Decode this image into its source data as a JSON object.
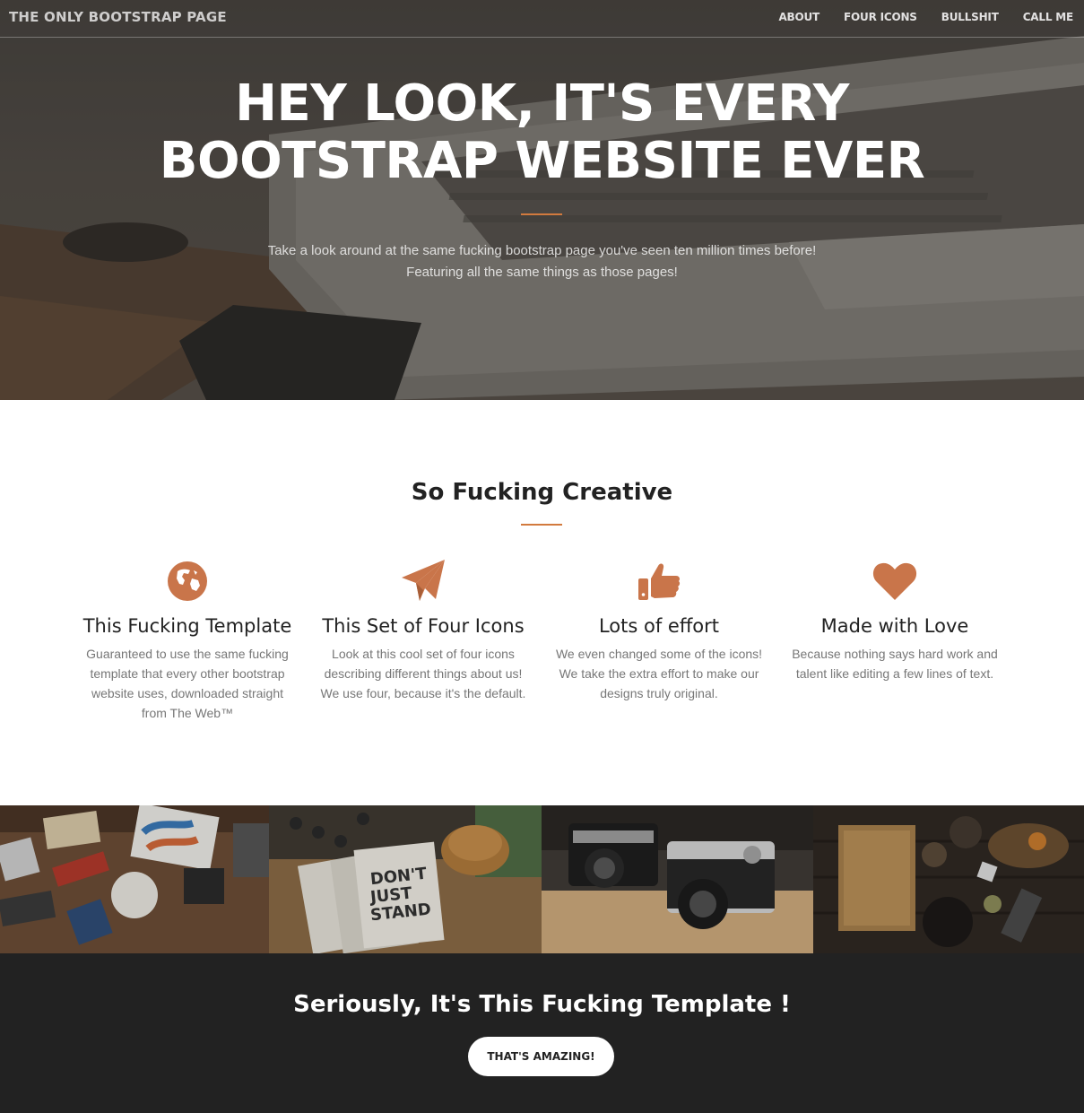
{
  "nav": {
    "brand": "THE ONLY BOOTSTRAP PAGE",
    "links": [
      "ABOUT",
      "FOUR ICONS",
      "BULLSHIT",
      "CALL ME"
    ]
  },
  "hero": {
    "title_line1": "HEY LOOK, IT'S EVERY",
    "title_line2": "BOOTSTRAP WEBSITE EVER",
    "subtitle_line1": "Take a look around at the same fucking bootstrap page you've seen ten million times before!",
    "subtitle_line2": "Featuring all the same things as those pages!"
  },
  "services": {
    "title": "So Fucking Creative",
    "accent_color": "#c9754a",
    "items": [
      {
        "icon": "globe-icon",
        "title": "This Fucking Template",
        "text": "Guaranteed to use the same fucking template that every other bootstrap website uses, downloaded straight from The Web™"
      },
      {
        "icon": "paper-plane-icon",
        "title": "This Set of Four Icons",
        "text": "Look at this cool set of four icons describing different things about us! We use four, because it's the default."
      },
      {
        "icon": "thumbs-up-icon",
        "title": "Lots of effort",
        "text": "We even changed some of the icons! We take the extra effort to make our designs truly original."
      },
      {
        "icon": "heart-icon",
        "title": "Made with Love",
        "text": "Because nothing says hard work and talent like editing a few lines of text."
      }
    ]
  },
  "cta": {
    "title": "Seriously, It's This Fucking Template !",
    "button": "THAT'S AMAZING!"
  },
  "colors": {
    "accent": "#d27a3e",
    "cta_bg": "#222222"
  }
}
